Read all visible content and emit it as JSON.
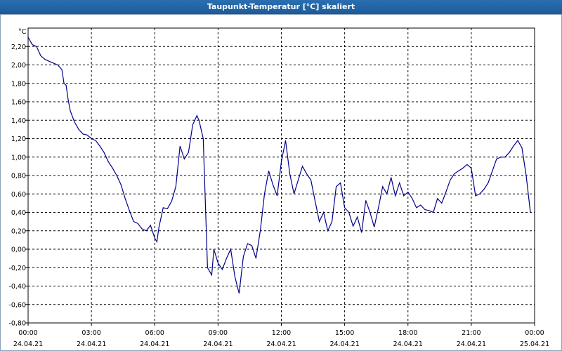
{
  "window": {
    "title": "Taupunkt-Temperatur [°C] skaliert"
  },
  "chart_data": {
    "type": "line",
    "title": "Taupunkt-Temperatur [°C] skaliert",
    "ylabel": "°C",
    "xlabel": "",
    "ylim": [
      -0.8,
      2.4
    ],
    "xlim": [
      0,
      24
    ],
    "grid": true,
    "y_ticks": [
      -0.8,
      -0.6,
      -0.4,
      -0.2,
      0.0,
      0.2,
      0.4,
      0.6,
      0.8,
      1.0,
      1.2,
      1.4,
      1.6,
      1.8,
      2.0,
      2.2
    ],
    "y_tick_labels": [
      "-0,80",
      "-0,60",
      "-0,40",
      "-0,20",
      "0,00",
      "0,20",
      "0,40",
      "0,60",
      "0,80",
      "1,00",
      "1,20",
      "1,40",
      "1,60",
      "1,80",
      "2,00",
      "2,20"
    ],
    "x_ticks": [
      0,
      3,
      6,
      9,
      12,
      15,
      18,
      21,
      24
    ],
    "x_tick_time_labels": [
      "00:00",
      "03:00",
      "06:00",
      "09:00",
      "12:00",
      "15:00",
      "18:00",
      "21:00",
      "00:00"
    ],
    "x_tick_date_labels": [
      "24.04.21",
      "24.04.21",
      "24.04.21",
      "24.04.21",
      "24.04.21",
      "24.04.21",
      "24.04.21",
      "24.04.21",
      "25.04.21"
    ],
    "colors": {
      "series": "#00008b",
      "grid": "#000000",
      "title_bar": "#1c5a99"
    },
    "series": [
      {
        "x": [
          0.0,
          0.2,
          0.4,
          0.6,
          0.8,
          1.0,
          1.2,
          1.4,
          1.6,
          1.7,
          1.8,
          1.9,
          2.0,
          2.2,
          2.4,
          2.6,
          2.8,
          3.0,
          3.2,
          3.4,
          3.6,
          3.8,
          4.0,
          4.2,
          4.4,
          4.6,
          4.8,
          5.0,
          5.2,
          5.4,
          5.6,
          5.8,
          6.0,
          6.1,
          6.2,
          6.4,
          6.6,
          6.8,
          7.0,
          7.2,
          7.4,
          7.6,
          7.8,
          8.0,
          8.1,
          8.2,
          8.3,
          8.5,
          8.7,
          8.8,
          9.0,
          9.2,
          9.4,
          9.6,
          9.8,
          10.0,
          10.2,
          10.4,
          10.6,
          10.8,
          11.0,
          11.2,
          11.4,
          11.6,
          11.8,
          12.0,
          12.2,
          12.4,
          12.6,
          12.8,
          13.0,
          13.2,
          13.4,
          13.6,
          13.8,
          14.0,
          14.2,
          14.4,
          14.6,
          14.8,
          15.0,
          15.2,
          15.4,
          15.6,
          15.8,
          16.0,
          16.2,
          16.4,
          16.6,
          16.8,
          17.0,
          17.2,
          17.4,
          17.6,
          17.8,
          18.0,
          18.2,
          18.4,
          18.6,
          18.8,
          19.0,
          19.2,
          19.4,
          19.6,
          19.8,
          20.0,
          20.2,
          20.4,
          20.6,
          20.8,
          21.0,
          21.2,
          21.4,
          21.6,
          21.8,
          22.0,
          22.2,
          22.4,
          22.6,
          22.8,
          23.0,
          23.2,
          23.4,
          23.6,
          23.8
        ],
        "y": [
          2.3,
          2.22,
          2.2,
          2.1,
          2.06,
          2.04,
          2.02,
          2.0,
          1.95,
          1.8,
          1.78,
          1.62,
          1.5,
          1.38,
          1.3,
          1.25,
          1.24,
          1.2,
          1.18,
          1.12,
          1.05,
          0.95,
          0.88,
          0.8,
          0.7,
          0.55,
          0.42,
          0.3,
          0.28,
          0.22,
          0.2,
          0.26,
          0.12,
          0.08,
          0.24,
          0.45,
          0.44,
          0.52,
          0.68,
          1.12,
          0.98,
          1.05,
          1.35,
          1.45,
          1.4,
          1.3,
          1.2,
          -0.2,
          -0.28,
          0.0,
          -0.15,
          -0.22,
          -0.1,
          0.0,
          -0.3,
          -0.48,
          -0.08,
          0.06,
          0.04,
          -0.1,
          0.2,
          0.6,
          0.85,
          0.7,
          0.58,
          0.95,
          1.18,
          0.82,
          0.6,
          0.75,
          0.9,
          0.82,
          0.75,
          0.52,
          0.3,
          0.4,
          0.2,
          0.3,
          0.68,
          0.72,
          0.45,
          0.4,
          0.25,
          0.35,
          0.18,
          0.53,
          0.4,
          0.24,
          0.45,
          0.68,
          0.6,
          0.78,
          0.58,
          0.72,
          0.58,
          0.62,
          0.55,
          0.45,
          0.48,
          0.43,
          0.42,
          0.4,
          0.55,
          0.5,
          0.62,
          0.75,
          0.82,
          0.85,
          0.88,
          0.92,
          0.88,
          0.58,
          0.6,
          0.65,
          0.72,
          0.85,
          0.98,
          1.0,
          1.0,
          1.05,
          1.12,
          1.18,
          1.1,
          0.8,
          0.4
        ]
      }
    ]
  }
}
